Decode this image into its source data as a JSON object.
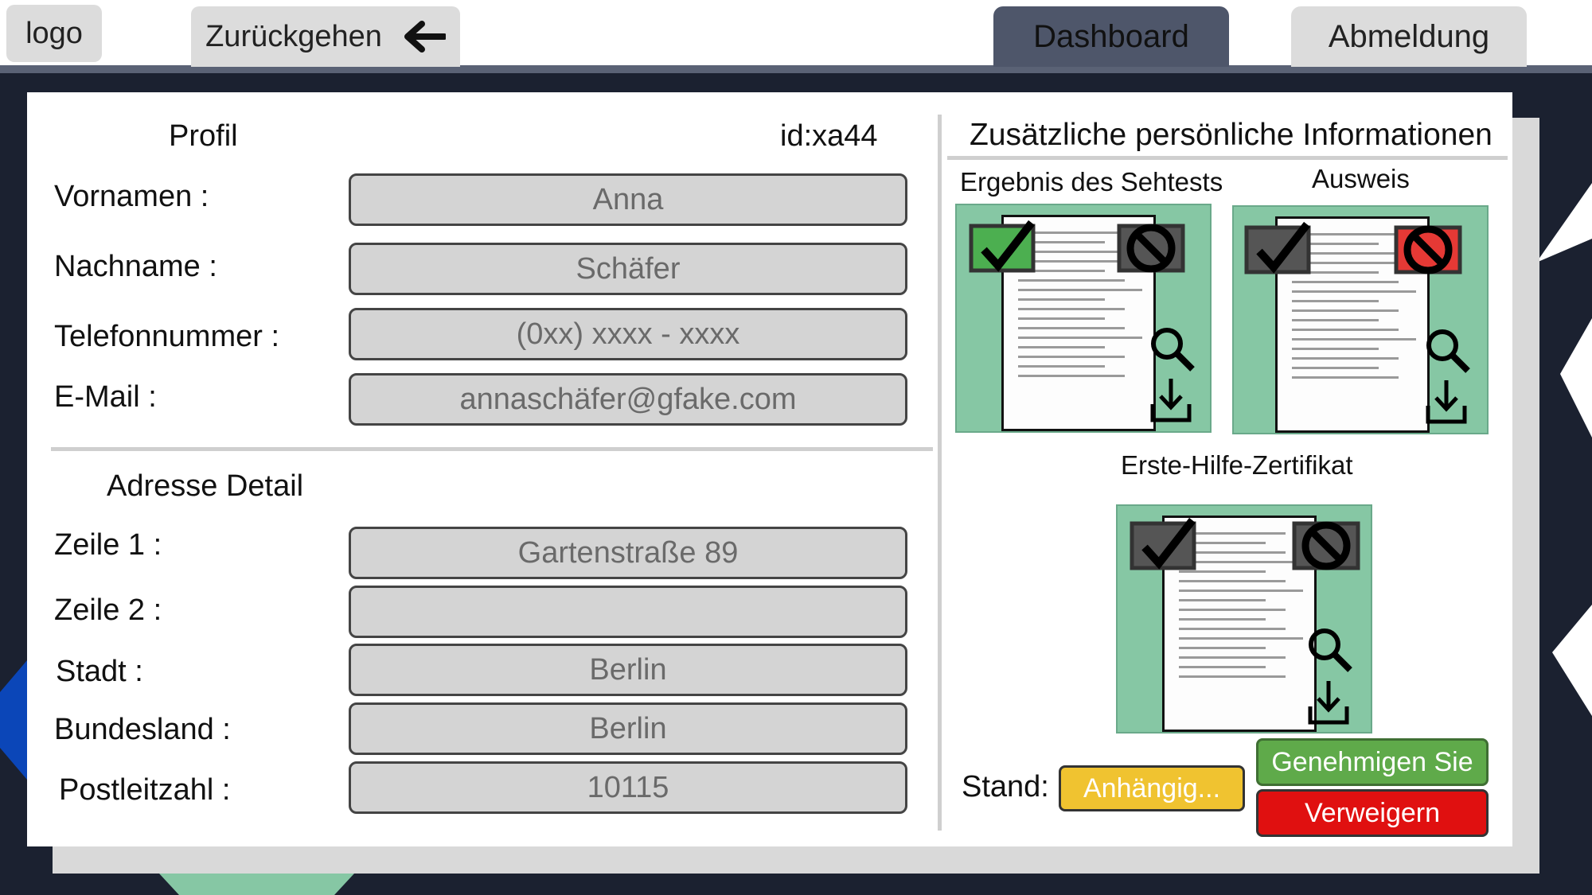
{
  "header": {
    "logo_label": "logo",
    "back_label": "Zurückgehen",
    "dashboard_label": "Dashboard",
    "logout_label": "Abmeldung"
  },
  "profile": {
    "title": "Profil",
    "id_text": "id:xa44",
    "fields": [
      {
        "label": "Vornamen :",
        "value": "Anna"
      },
      {
        "label": "Nachname :",
        "value": "Schäfer"
      },
      {
        "label": "Telefonnummer :",
        "value": "(0xx) xxxx - xxxx"
      },
      {
        "label": "E-Mail :",
        "value": "annaschäfer@gfake.com"
      }
    ]
  },
  "address": {
    "title": "Adresse Detail",
    "fields": [
      {
        "label": "Zeile 1 :",
        "value": "Gartenstraße 89"
      },
      {
        "label": "Zeile 2 :",
        "value": ""
      },
      {
        "label": "Stadt :",
        "value": "Berlin"
      },
      {
        "label": "Bundesland :",
        "value": "Berlin"
      },
      {
        "label": "Postleitzahl :",
        "value": "10115"
      }
    ]
  },
  "additional": {
    "title": "Zusätzliche persönliche Informationen",
    "documents": [
      {
        "title": "Ergebnis des Sehtests",
        "approve_color": "#4caf50",
        "deny_color": "#555555"
      },
      {
        "title": "Ausweis",
        "approve_color": "#555555",
        "deny_color": "#e53935"
      },
      {
        "title": "Erste-Hilfe-Zertifikat",
        "approve_color": "#555555",
        "deny_color": "#555555"
      }
    ]
  },
  "status": {
    "label": "Stand:",
    "value": "Anhängig...",
    "approve_label": "Genehmigen Sie",
    "deny_label": "Verweigern",
    "colors": {
      "pending": "#f0c330",
      "approve": "#5faa4a",
      "deny": "#e01010"
    }
  }
}
